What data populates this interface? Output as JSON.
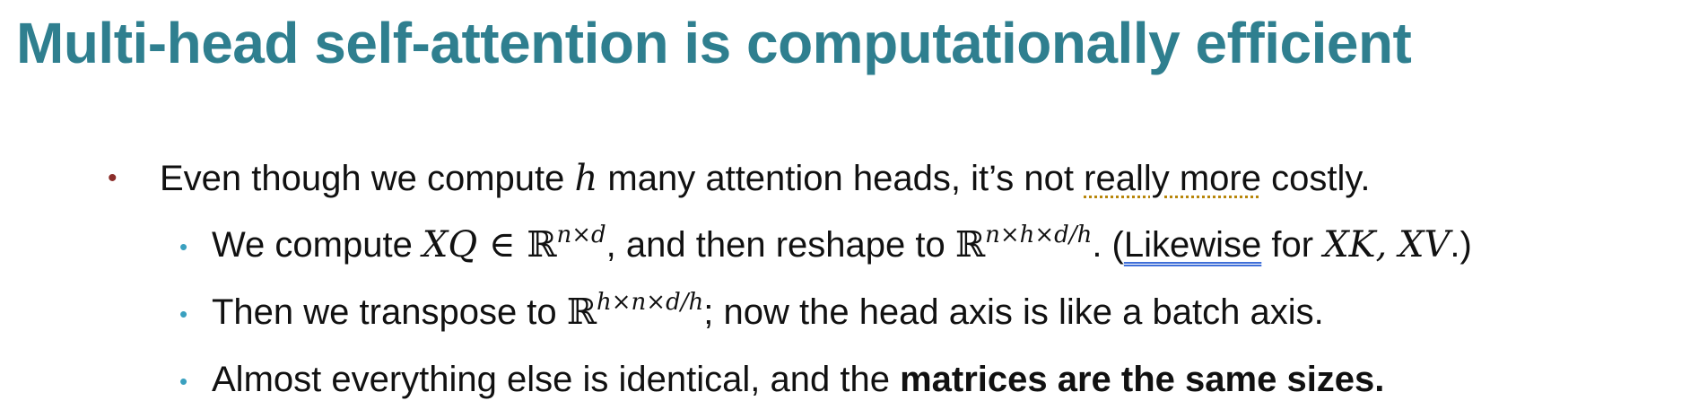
{
  "title": "Multi-head self-attention is computationally efficient",
  "bullet1": {
    "pre": "Even though we compute ",
    "var_h": "h",
    "mid": " many attention heads, it’s not ",
    "flagged": "really more",
    "post": " costly."
  },
  "bullet2": {
    "pre": "We compute ",
    "expr": "XQ ∈ ",
    "bb": "ℝ",
    "exp1": "n×d",
    "mid": ", and then reshape to ",
    "bb2": "ℝ",
    "exp2": "n×h×d/h",
    "mid2": ". (",
    "flagged": "Likewise",
    "mid3": " for ",
    "vars": "XK, XV",
    "post": ".)"
  },
  "bullet3": {
    "pre": "Then we transpose to ",
    "bb": "ℝ",
    "exp": "h×n×d/h",
    "post": "; now the head axis is like a batch axis."
  },
  "bullet4": {
    "pre": "Almost everything else is identical, and the ",
    "bold": "matrices are the same sizes."
  },
  "colors": {
    "title": "#2f7f8f",
    "main_bullet": "#8b2e2a",
    "sub_bullet": "#3aa0bf"
  }
}
